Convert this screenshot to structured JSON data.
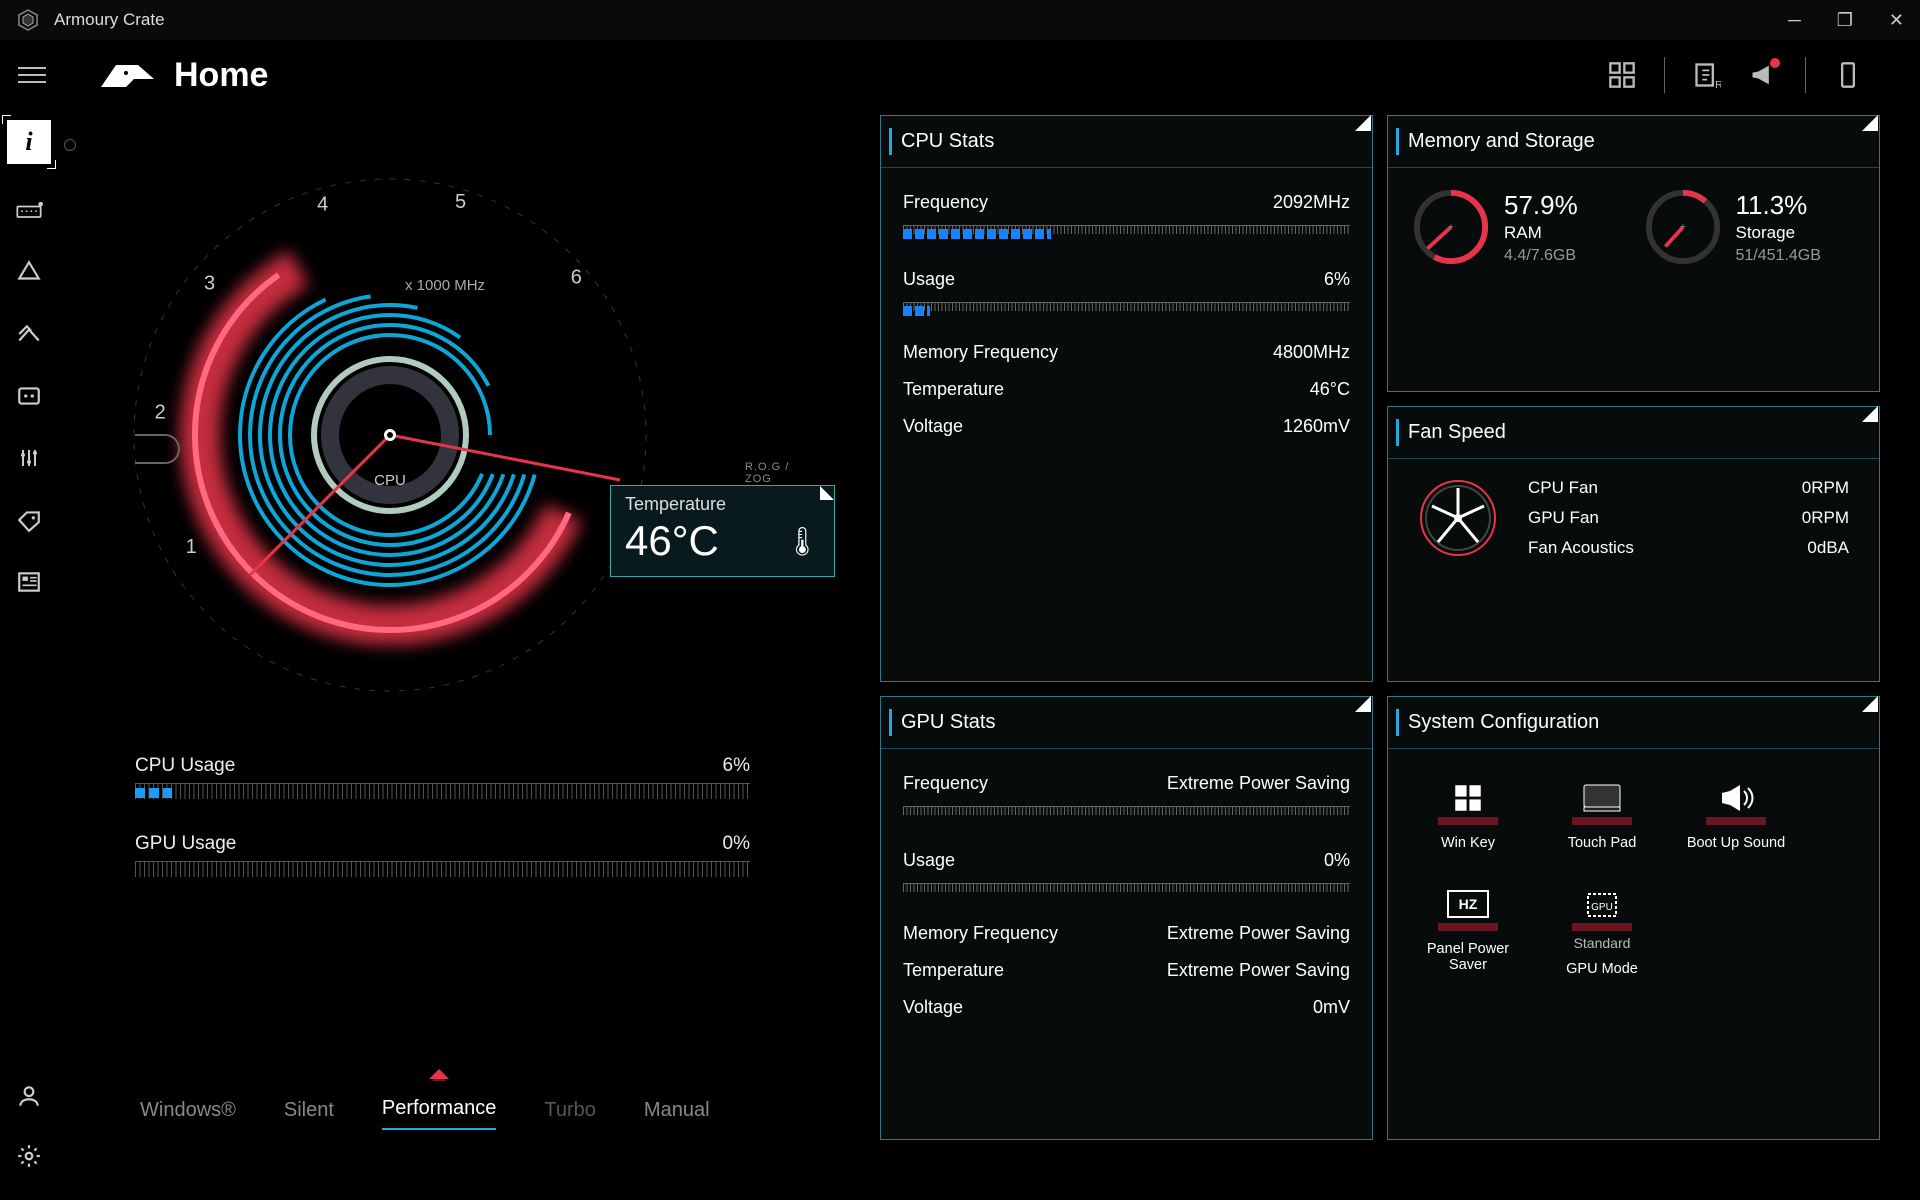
{
  "app_title": "Armoury Crate",
  "page_title": "Home",
  "gauge": {
    "scale_label": "x 1000 MHz",
    "center_label": "CPU",
    "rog_badge": "R.O.G / ZOG",
    "tick_labels": [
      "1",
      "2",
      "3",
      "4",
      "5",
      "6"
    ]
  },
  "temp_box": {
    "label": "Temperature",
    "value": "46°C"
  },
  "left_usage": {
    "cpu": {
      "label": "CPU Usage",
      "value": "6%",
      "pct": 6
    },
    "gpu": {
      "label": "GPU Usage",
      "value": "0%",
      "pct": 0
    }
  },
  "modes": {
    "items": [
      "Windows®",
      "Silent",
      "Performance",
      "Turbo",
      "Manual"
    ],
    "active": 2
  },
  "cpu_stats": {
    "title": "CPU Stats",
    "frequency": {
      "label": "Frequency",
      "value": "2092MHz",
      "pct": 33
    },
    "usage": {
      "label": "Usage",
      "value": "6%",
      "pct": 6
    },
    "rows": [
      {
        "label": "Memory Frequency",
        "value": "4800MHz"
      },
      {
        "label": "Temperature",
        "value": "46°C"
      },
      {
        "label": "Voltage",
        "value": "1260mV"
      }
    ]
  },
  "memory": {
    "title": "Memory and Storage",
    "ram": {
      "pct": "57.9%",
      "name": "RAM",
      "sub": "4.4/7.6GB",
      "fill": 57.9,
      "color": "#e6354a"
    },
    "storage": {
      "pct": "11.3%",
      "name": "Storage",
      "sub": "51/451.4GB",
      "fill": 11.3,
      "color": "#e6354a"
    }
  },
  "fan": {
    "title": "Fan Speed",
    "rows": [
      {
        "label": "CPU Fan",
        "value": "0RPM"
      },
      {
        "label": "GPU Fan",
        "value": "0RPM"
      },
      {
        "label": "Fan Acoustics",
        "value": "0dBA"
      }
    ]
  },
  "gpu_stats": {
    "title": "GPU Stats",
    "frequency": {
      "label": "Frequency",
      "value": "Extreme Power Saving",
      "pct": 0
    },
    "usage": {
      "label": "Usage",
      "value": "0%",
      "pct": 0
    },
    "rows": [
      {
        "label": "Memory Frequency",
        "value": "Extreme Power Saving"
      },
      {
        "label": "Temperature",
        "value": "Extreme Power Saving"
      },
      {
        "label": "Voltage",
        "value": "0mV"
      }
    ]
  },
  "sys": {
    "title": "System Configuration",
    "items": [
      {
        "label": "Win Key",
        "icon": "winkey"
      },
      {
        "label": "Touch Pad",
        "icon": "touchpad"
      },
      {
        "label": "Boot Up Sound",
        "icon": "bootsound"
      },
      {
        "label": "Panel Power Saver",
        "icon": "hz"
      },
      {
        "label": "GPU Mode",
        "sublabel": "Standard",
        "icon": "gpu"
      }
    ]
  }
}
